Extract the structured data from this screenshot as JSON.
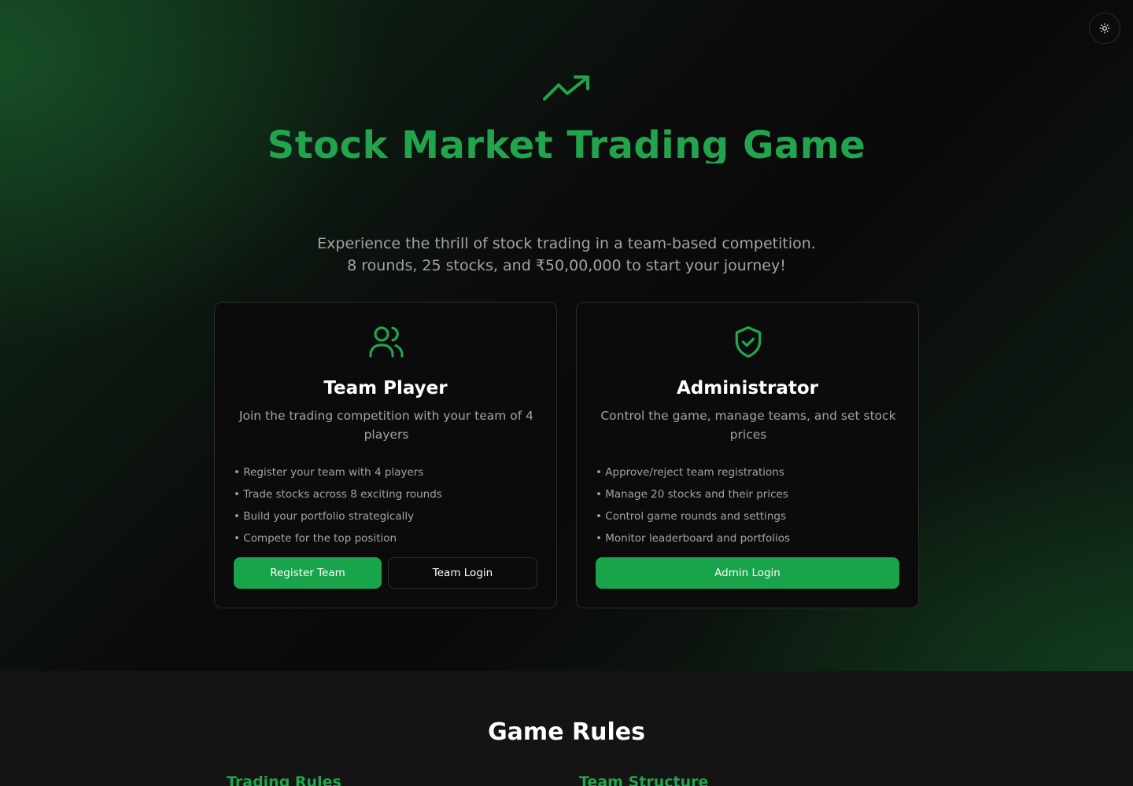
{
  "theme": {
    "accent": "#22a44e",
    "button": "#19a34a",
    "background": "#0a0a0a",
    "section_bg": "#141414",
    "muted_text": "#a3a3a3"
  },
  "header": {
    "theme_toggle_icon": "sun-icon"
  },
  "hero": {
    "icon": "trending-up-icon",
    "title": "Stock Market Trading Game",
    "subtitle_line1": "Experience the thrill of stock trading in a team-based competition.",
    "subtitle_line2": "8 rounds, 25 stocks, and ₹50,00,000 to start your journey!"
  },
  "cards": {
    "team": {
      "icon": "users-icon",
      "title": "Team Player",
      "description": "Join the trading competition with your team of 4 players",
      "features": [
        "Register your team with 4 players",
        "Trade stocks across 8 exciting rounds",
        "Build your portfolio strategically",
        "Compete for the top position"
      ],
      "register_label": "Register Team",
      "login_label": "Team Login"
    },
    "admin": {
      "icon": "shield-check-icon",
      "title": "Administrator",
      "description": "Control the game, manage teams, and set stock prices",
      "features": [
        "Approve/reject team registrations",
        "Manage 20 stocks and their prices",
        "Control game rounds and settings",
        "Monitor leaderboard and portfolios"
      ],
      "login_label": "Admin Login"
    }
  },
  "rules": {
    "title": "Game Rules",
    "trading_heading": "Trading Rules",
    "team_heading": "Team Structure"
  }
}
